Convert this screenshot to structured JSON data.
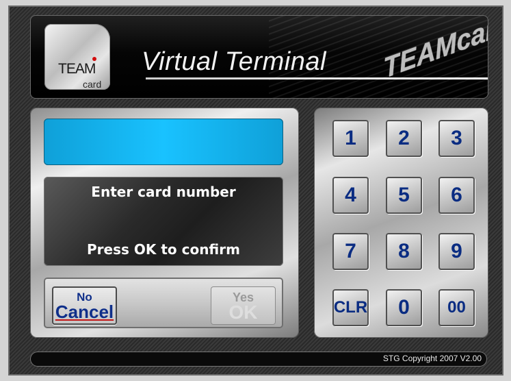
{
  "header": {
    "logo_team": "TEAM",
    "logo_card": "card",
    "title": "Virtual Terminal",
    "brand_mark": "TEAMcard"
  },
  "display": {
    "value": ""
  },
  "messages": {
    "line1": "Enter card number",
    "line2": "Press OK to confirm"
  },
  "buttons": {
    "cancel_top": "No",
    "cancel_label": "Cancel",
    "ok_top": "Yes",
    "ok_label": "OK"
  },
  "keypad": {
    "keys": [
      "1",
      "2",
      "3",
      "4",
      "5",
      "6",
      "7",
      "8",
      "9",
      "CLR",
      "0",
      "00"
    ]
  },
  "footer": {
    "copyright": "STG Copyright 2007  V2.00"
  },
  "colors": {
    "display_cyan": "#19c2ff",
    "key_text": "#0a2c82",
    "cancel_underline": "#c21515"
  }
}
